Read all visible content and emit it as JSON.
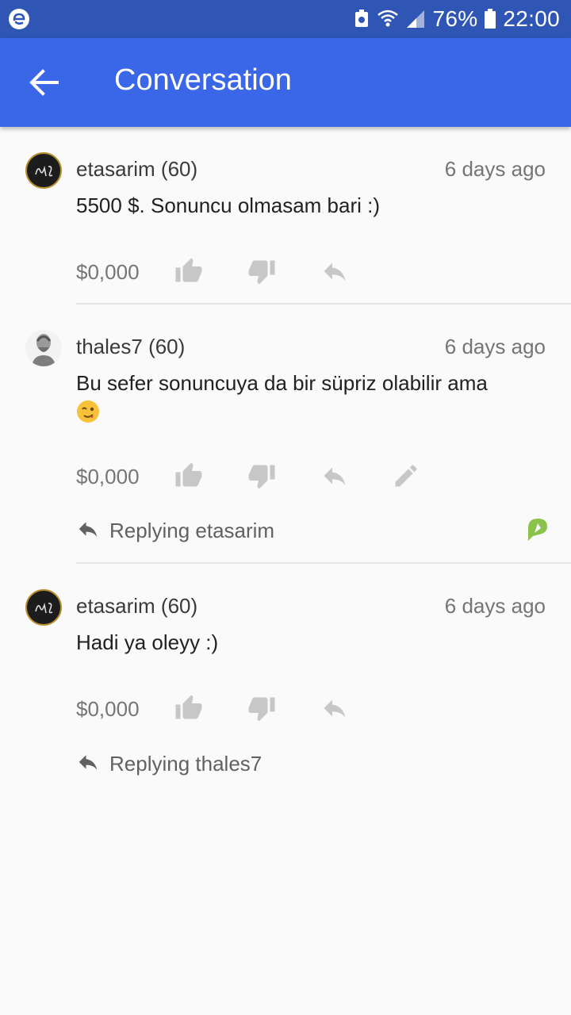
{
  "status_bar": {
    "battery_percent": "76%",
    "time": "22:00"
  },
  "app_bar": {
    "title": "Conversation"
  },
  "comments": [
    {
      "author": "etasarim (60)",
      "time_ago": "6 days ago",
      "text": "5500 $. Sonuncu olmasam bari :)",
      "amount": "$0,000"
    },
    {
      "author": "thales7 (60)",
      "time_ago": "6 days ago",
      "text": "Bu sefer sonuncuya da bir süpriz olabilir ama",
      "emoji": "winking-face",
      "amount": "$0,000",
      "replying": "Replying etasarim"
    },
    {
      "author": "etasarim (60)",
      "time_ago": "6 days ago",
      "text": "Hadi ya oleyy :)",
      "amount": "$0,000",
      "replying": "Replying thales7"
    }
  ],
  "colors": {
    "status_bar": "#2f56b5",
    "app_bar": "#3a66e8",
    "background": "#fafafa",
    "action_icon": "#c7c7c7",
    "badge": "#8bc34a"
  }
}
